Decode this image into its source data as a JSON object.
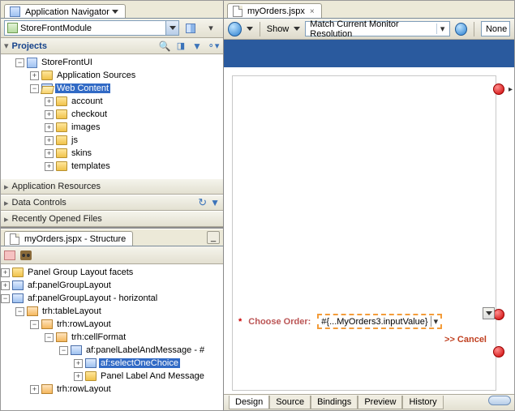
{
  "nav": {
    "tab_title": "Application Navigator",
    "module": "StoreFrontModule",
    "projects_title": "Projects",
    "tree": {
      "root": "StoreFrontUI",
      "app_sources": "Application Sources",
      "web_content": "Web Content",
      "folders": [
        "account",
        "checkout",
        "images",
        "js",
        "skins",
        "templates"
      ]
    },
    "accordion": {
      "app_resources": "Application Resources",
      "data_controls": "Data Controls",
      "recent_files": "Recently Opened Files"
    }
  },
  "structure": {
    "tab_title": "myOrders.jspx - Structure",
    "items": {
      "facets": "Panel Group Layout facets",
      "pgl": "af:panelGroupLayout",
      "pgl_h": "af:panelGroupLayout - horizontal",
      "table": "trh:tableLayout",
      "row": "trh:rowLayout",
      "cell": "trh:cellFormat",
      "plm": "af:panelLabelAndMessage - #",
      "soc": "af:selectOneChoice",
      "plm2": "Panel Label And Message",
      "row2": "trh:rowLayout"
    }
  },
  "editor": {
    "tab_title": "myOrders.jspx",
    "show_label": "Show",
    "resolution": "Match Current Monitor Resolution",
    "none_label": "None",
    "form_label": "Choose Order:",
    "form_value": "#{...MyOrders3.inputValue}",
    "cancel": ">> Cancel",
    "bottom_tabs": [
      "Design",
      "Source",
      "Bindings",
      "Preview",
      "History"
    ]
  }
}
